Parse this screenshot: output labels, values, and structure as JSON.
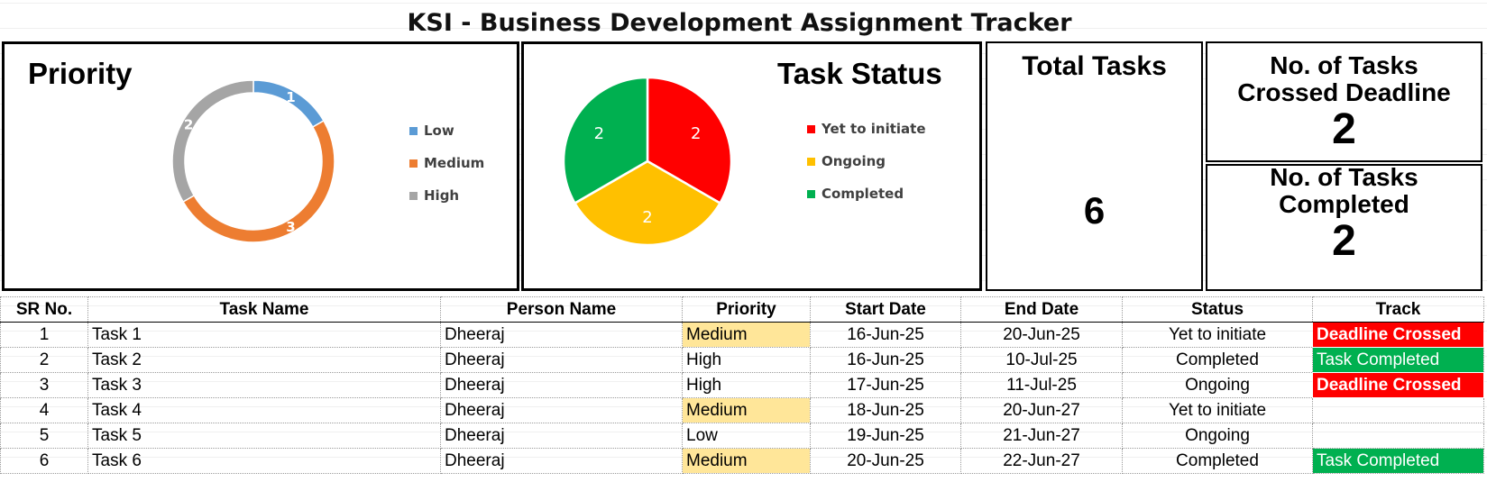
{
  "title": "KSI - Business Development Assignment Tracker",
  "colors": {
    "low": "#5b9bd5",
    "medium": "#ed7d31",
    "high": "#a5a5a5",
    "yet_to_initiate": "#ff0000",
    "ongoing": "#ffc000",
    "completed": "#00b050",
    "deadline_crossed": "#ff0000",
    "task_completed": "#00b050",
    "medium_highlight": "#ffe699"
  },
  "kpis": {
    "total_label": "Total Tasks",
    "total_value": "6",
    "crossed_label_1": "No. of Tasks",
    "crossed_label_2": "Crossed Deadline",
    "crossed_value": "2",
    "completed_label_1": "No. of Tasks",
    "completed_label_2": "Completed",
    "completed_value": "2"
  },
  "chart_data": [
    {
      "type": "pie",
      "variant": "doughnut",
      "title": "Priority",
      "categories": [
        "Low",
        "Medium",
        "High"
      ],
      "values": [
        1,
        3,
        2
      ],
      "legend": "right"
    },
    {
      "type": "pie",
      "title": "Task Status",
      "categories": [
        "Yet to initiate",
        "Ongoing",
        "Completed"
      ],
      "values": [
        2,
        2,
        2
      ],
      "legend": "right"
    }
  ],
  "table": {
    "columns": [
      "SR No.",
      "Task Name",
      "Person Name",
      "Priority",
      "Start Date",
      "End Date",
      "Status",
      "Track"
    ],
    "rows": [
      {
        "sr": "1",
        "task": "Task 1",
        "person": "Dheeraj",
        "priority": "Medium",
        "start": "16-Jun-25",
        "end": "20-Jun-25",
        "status": "Yet to initiate",
        "track": "Deadline Crossed"
      },
      {
        "sr": "2",
        "task": "Task 2",
        "person": "Dheeraj",
        "priority": "High",
        "start": "16-Jun-25",
        "end": "10-Jul-25",
        "status": "Completed",
        "track": "Task Completed"
      },
      {
        "sr": "3",
        "task": "Task 3",
        "person": "Dheeraj",
        "priority": "High",
        "start": "17-Jun-25",
        "end": "11-Jul-25",
        "status": "Ongoing",
        "track": "Deadline Crossed"
      },
      {
        "sr": "4",
        "task": "Task 4",
        "person": "Dheeraj",
        "priority": "Medium",
        "start": "18-Jun-25",
        "end": "20-Jun-27",
        "status": "Yet to initiate",
        "track": ""
      },
      {
        "sr": "5",
        "task": "Task 5",
        "person": "Dheeraj",
        "priority": "Low",
        "start": "19-Jun-25",
        "end": "21-Jun-27",
        "status": "Ongoing",
        "track": ""
      },
      {
        "sr": "6",
        "task": "Task 6",
        "person": "Dheeraj",
        "priority": "Medium",
        "start": "20-Jun-25",
        "end": "22-Jun-27",
        "status": "Completed",
        "track": "Task Completed"
      }
    ]
  }
}
